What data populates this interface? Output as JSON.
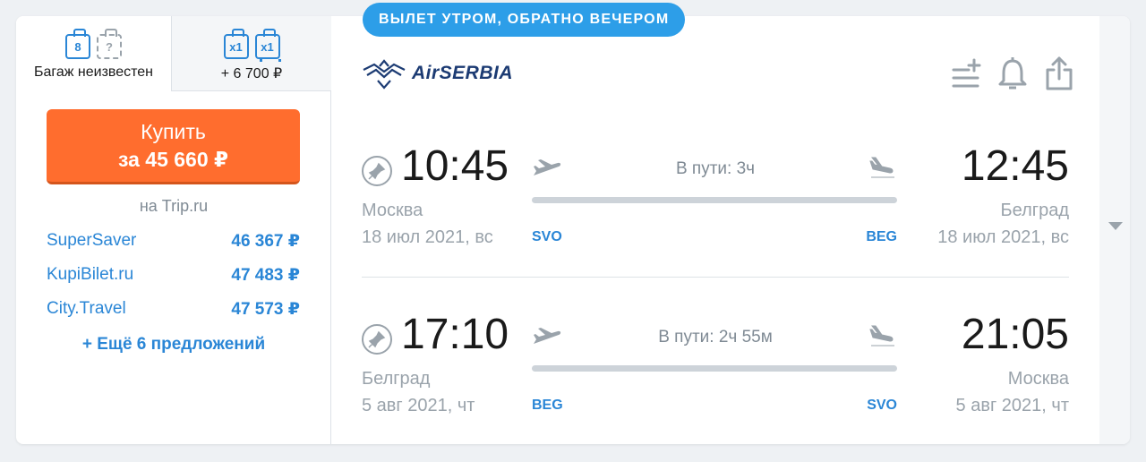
{
  "badge": "ВЫЛЕТ УТРОМ, ОБРАТНО ВЕЧЕРОМ",
  "baggage": {
    "tab1": {
      "carry_on": "8",
      "checked": "?",
      "label": "Багаж неизвестен"
    },
    "tab2": {
      "carry_on": "x1",
      "checked": "x1",
      "label": "+ 6 700 ₽"
    }
  },
  "buy": {
    "line1": "Купить",
    "line2": "за 45 660 ₽",
    "agent": "на Trip.ru"
  },
  "offers": [
    {
      "name": "SuperSaver",
      "price": "46 367 ₽"
    },
    {
      "name": "KupiBilet.ru",
      "price": "47 483 ₽"
    },
    {
      "name": "City.Travel",
      "price": "47 573 ₽"
    }
  ],
  "more_offers": "+ Ещё 6 предложений",
  "airline": {
    "name": "AirSERBIA"
  },
  "icons": {
    "actions": [
      "list-add-icon",
      "bell-icon",
      "share-icon"
    ]
  },
  "colors": {
    "accent": "#2a86d6",
    "buy": "#ff6d2e",
    "badge": "#2d9ee8"
  },
  "segments": [
    {
      "dep_time": "10:45",
      "arr_time": "12:45",
      "dep_city": "Москва",
      "arr_city": "Белград",
      "dep_date": "18 июл 2021, вс",
      "arr_date": "18 июл 2021, вс",
      "duration": "В пути: 3ч",
      "dep_code": "SVO",
      "arr_code": "BEG"
    },
    {
      "dep_time": "17:10",
      "arr_time": "21:05",
      "dep_city": "Белград",
      "arr_city": "Москва",
      "dep_date": "5 авг 2021, чт",
      "arr_date": "5 авг 2021, чт",
      "duration": "В пути: 2ч 55м",
      "dep_code": "BEG",
      "arr_code": "SVO"
    }
  ]
}
